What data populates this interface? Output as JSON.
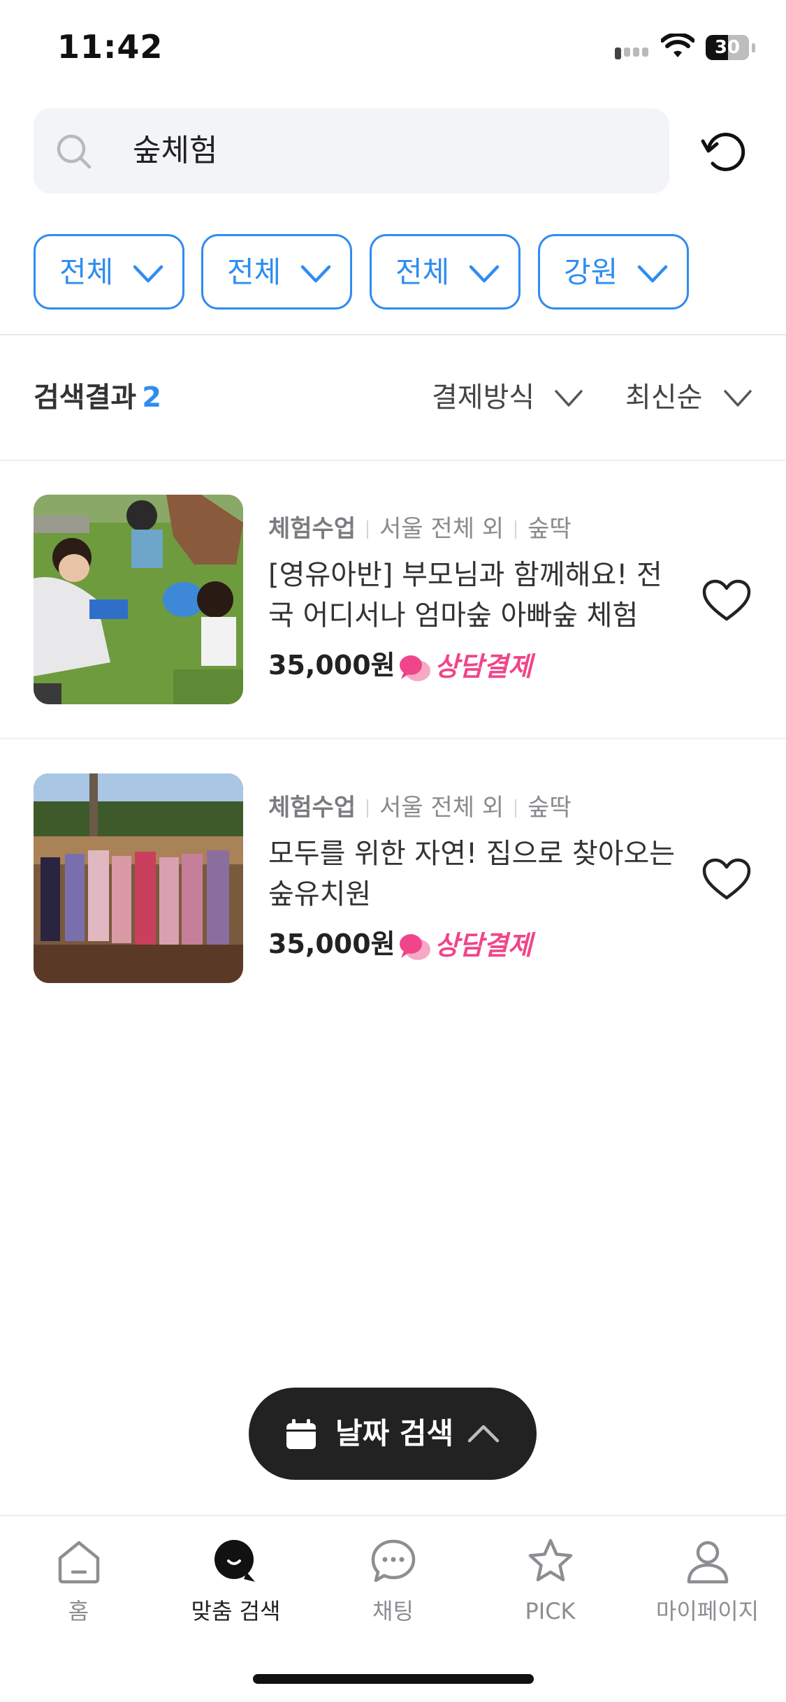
{
  "status_bar": {
    "time": "11:42",
    "battery": "30"
  },
  "search": {
    "query": "숲체험"
  },
  "filters": [
    {
      "label": "전체"
    },
    {
      "label": "전체"
    },
    {
      "label": "전체"
    },
    {
      "label": "강원"
    }
  ],
  "results_header": {
    "label": "검색결과",
    "count": "2",
    "sort_payment": "결제방식",
    "sort_order": "최신순"
  },
  "items": [
    {
      "category": "체험수업",
      "region": "서울 전체 외",
      "provider": "숲딱",
      "title": "[영유아반] 부모님과 함께해요! 전국 어디서나 엄마숲 아빠숲 체험",
      "price": "35,000원",
      "payment": "상담결제"
    },
    {
      "category": "체험수업",
      "region": "서울 전체 외",
      "provider": "숲딱",
      "title": "모두를 위한 자연! 집으로 찾아오는 숲유치원",
      "price": "35,000원",
      "payment": "상담결제"
    }
  ],
  "date_search": {
    "label": "날짜 검색"
  },
  "tabbar": [
    {
      "label": "홈",
      "icon": "home-icon"
    },
    {
      "label": "맞춤 검색",
      "icon": "custom-search-icon"
    },
    {
      "label": "채팅",
      "icon": "chat-icon"
    },
    {
      "label": "PICK",
      "icon": "star-icon"
    },
    {
      "label": "마이페이지",
      "icon": "profile-icon"
    }
  ],
  "colors": {
    "accent": "#2f8df0",
    "pay_pink": "#f0458a",
    "dark": "#222222"
  }
}
